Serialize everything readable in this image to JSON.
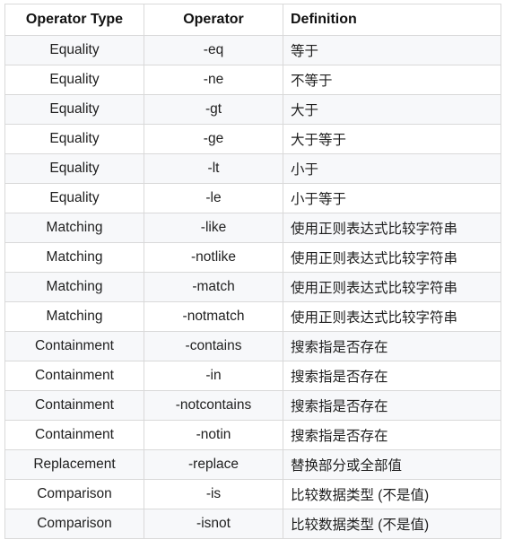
{
  "table": {
    "headers": [
      "Operator Type",
      "Operator",
      "Definition"
    ],
    "rows": [
      {
        "type": "Equality",
        "operator": "-eq",
        "definition": "等于"
      },
      {
        "type": "Equality",
        "operator": "-ne",
        "definition": "不等于"
      },
      {
        "type": "Equality",
        "operator": "-gt",
        "definition": "大于"
      },
      {
        "type": "Equality",
        "operator": "-ge",
        "definition": "大于等于"
      },
      {
        "type": "Equality",
        "operator": "-lt",
        "definition": "小于"
      },
      {
        "type": "Equality",
        "operator": "-le",
        "definition": "小于等于"
      },
      {
        "type": "Matching",
        "operator": "-like",
        "definition": "使用正则表达式比较字符串"
      },
      {
        "type": "Matching",
        "operator": "-notlike",
        "definition": "使用正则表达式比较字符串"
      },
      {
        "type": "Matching",
        "operator": "-match",
        "definition": "使用正则表达式比较字符串"
      },
      {
        "type": "Matching",
        "operator": "-notmatch",
        "definition": "使用正则表达式比较字符串"
      },
      {
        "type": "Containment",
        "operator": "-contains",
        "definition": "搜索指是否存在"
      },
      {
        "type": "Containment",
        "operator": "-in",
        "definition": "搜索指是否存在"
      },
      {
        "type": "Containment",
        "operator": "-notcontains",
        "definition": "搜索指是否存在"
      },
      {
        "type": "Containment",
        "operator": "-notin",
        "definition": "搜索指是否存在"
      },
      {
        "type": "Replacement",
        "operator": "-replace",
        "definition": "替换部分或全部值"
      },
      {
        "type": "Comparison",
        "operator": "-is",
        "definition": "比较数据类型 (不是值)"
      },
      {
        "type": "Comparison",
        "operator": "-isnot",
        "definition": "比较数据类型 (不是值)"
      }
    ]
  }
}
